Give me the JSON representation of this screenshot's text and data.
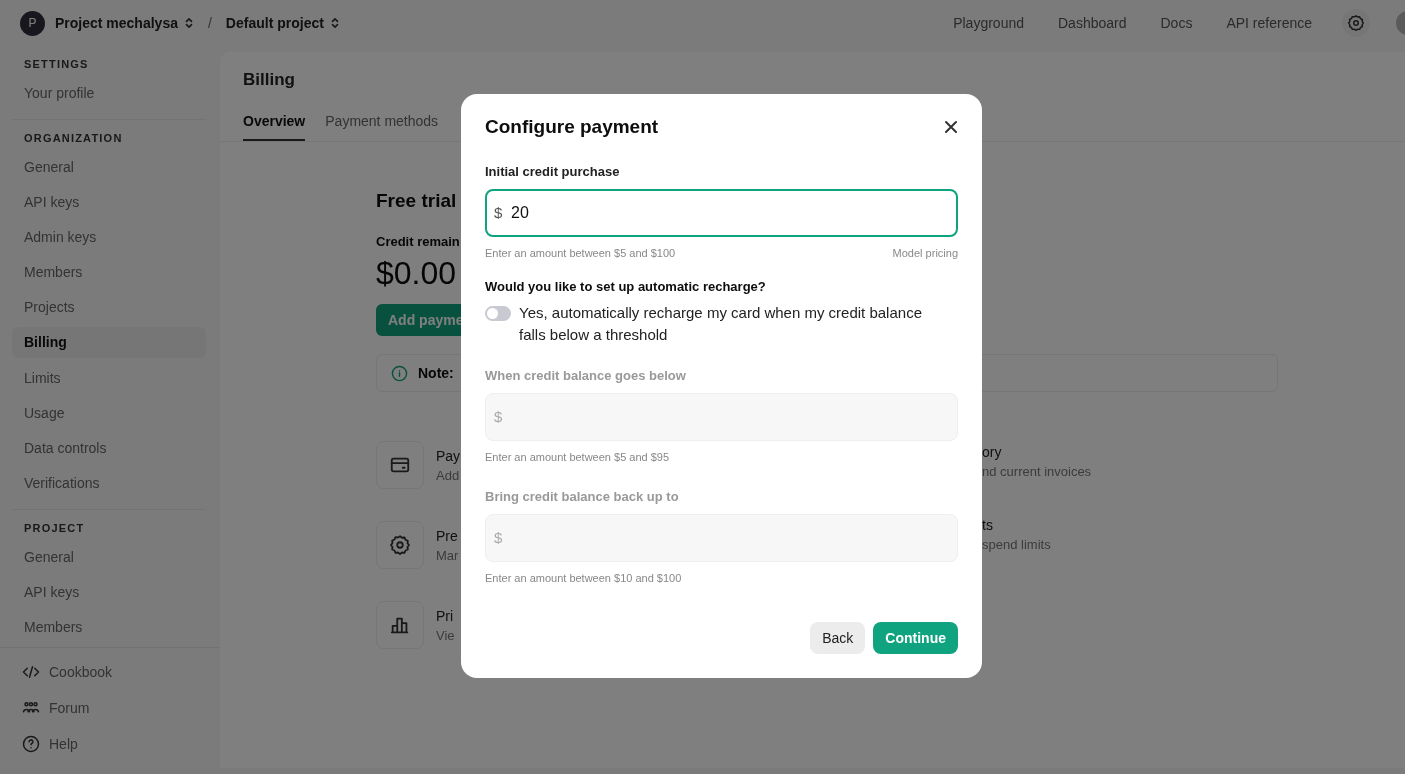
{
  "topbar": {
    "avatar": "P",
    "organization": "Project mechalysa",
    "separator": "/",
    "project": "Default project",
    "links": [
      "Playground",
      "Dashboard",
      "Docs",
      "API reference"
    ]
  },
  "sidebar": {
    "sections": [
      {
        "heading": "SETTINGS",
        "items": [
          {
            "label": "Your profile",
            "selected": false
          }
        ]
      },
      {
        "heading": "ORGANIZATION",
        "items": [
          {
            "label": "General",
            "selected": false
          },
          {
            "label": "API keys",
            "selected": false
          },
          {
            "label": "Admin keys",
            "selected": false
          },
          {
            "label": "Members",
            "selected": false
          },
          {
            "label": "Projects",
            "selected": false
          },
          {
            "label": "Billing",
            "selected": true
          },
          {
            "label": "Limits",
            "selected": false
          },
          {
            "label": "Usage",
            "selected": false
          },
          {
            "label": "Data controls",
            "selected": false
          },
          {
            "label": "Verifications",
            "selected": false
          }
        ]
      },
      {
        "heading": "PROJECT",
        "items": [
          {
            "label": "General",
            "selected": false
          },
          {
            "label": "API keys",
            "selected": false
          },
          {
            "label": "Members",
            "selected": false
          }
        ]
      }
    ],
    "footer": [
      {
        "label": "Cookbook",
        "kind": "code"
      },
      {
        "label": "Forum",
        "kind": "people"
      },
      {
        "label": "Help",
        "kind": "help"
      }
    ]
  },
  "page": {
    "title": "Billing",
    "tabs": [
      {
        "label": "Overview",
        "selected": true
      },
      {
        "label": "Payment methods",
        "selected": false
      }
    ],
    "heading": "Free trial",
    "credit_label": "Credit remain",
    "balance": "$0.00",
    "add_button": "Add payme",
    "note_label": "Note:",
    "cards_left": [
      {
        "kind": "card",
        "title": "Pay",
        "description": "Add"
      },
      {
        "kind": "gear",
        "title": "Pre",
        "description": "Mar"
      },
      {
        "kind": "chart",
        "title": "Pri",
        "description": "Vie"
      }
    ],
    "cards_right": [
      {
        "title": "ory",
        "description": "nd current invoices"
      },
      {
        "title": "ts",
        "description": "spend limits"
      }
    ]
  },
  "modal": {
    "title": "Configure payment",
    "purchase": {
      "label": "Initial credit purchase",
      "prefix": "$",
      "value": "20",
      "focused": true,
      "hint": "Enter an amount between $5 and $100",
      "link": "Model pricing"
    },
    "question": "Would you like to set up automatic recharge?",
    "recharge": {
      "on": false,
      "label": "Yes, automatically recharge my card when my credit balance falls below a threshold"
    },
    "fields": [
      {
        "label": "When credit balance goes below",
        "prefix": "$",
        "disabled": true,
        "hint": "Enter an amount between $5 and $95"
      },
      {
        "label": "Bring credit balance back up to",
        "prefix": "$",
        "disabled": true,
        "hint": "Enter an amount between $10 and $100"
      }
    ],
    "buttons": [
      {
        "label": "Back",
        "kind": "secondary"
      },
      {
        "label": "Continue",
        "kind": "primary"
      }
    ]
  }
}
